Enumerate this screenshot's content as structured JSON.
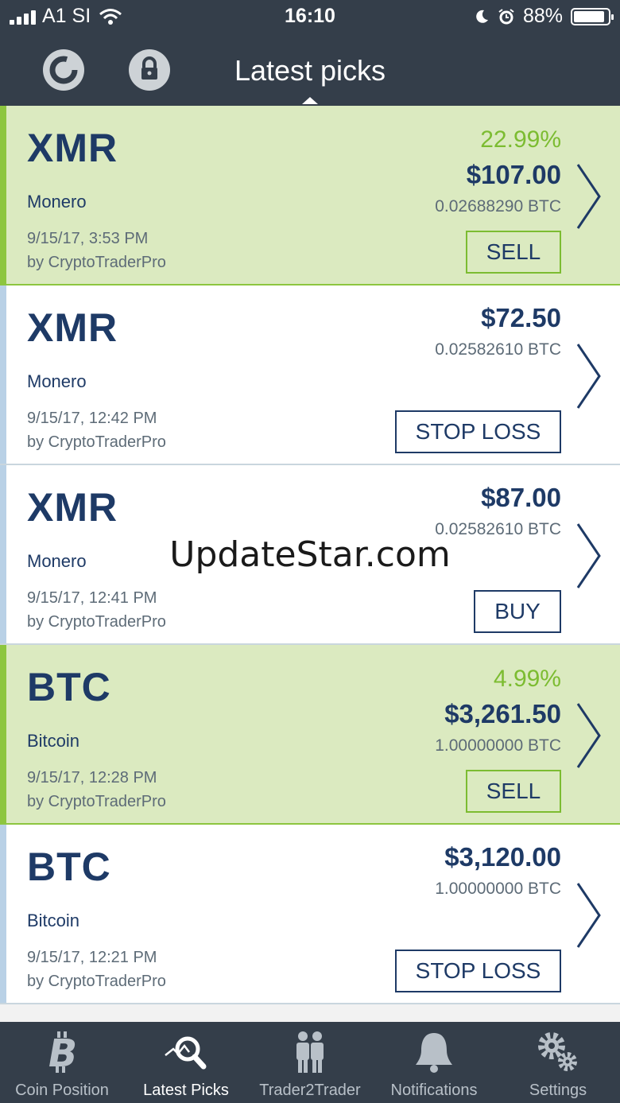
{
  "status_bar": {
    "carrier": "A1 SI",
    "time": "16:10",
    "battery": "88%"
  },
  "nav": {
    "title": "Latest picks",
    "icons": [
      "refresh-icon",
      "lock-icon"
    ]
  },
  "watermark": "UpdateStar.com",
  "picks": [
    {
      "symbol": "XMR",
      "name": "Monero",
      "date": "9/15/17, 3:53 PM",
      "author": "by CryptoTraderPro",
      "percent": "22.99%",
      "price": "$107.00",
      "btc": "0.02688290 BTC",
      "action": "SELL",
      "state": "positive"
    },
    {
      "symbol": "XMR",
      "name": "Monero",
      "date": "9/15/17, 12:42 PM",
      "author": "by CryptoTraderPro",
      "price": "$72.50",
      "btc": "0.02582610 BTC",
      "action": "STOP LOSS",
      "state": "neutral"
    },
    {
      "symbol": "XMR",
      "name": "Monero",
      "date": "9/15/17, 12:41 PM",
      "author": "by CryptoTraderPro",
      "price": "$87.00",
      "btc": "0.02582610 BTC",
      "action": "BUY",
      "state": "neutral"
    },
    {
      "symbol": "BTC",
      "name": "Bitcoin",
      "date": "9/15/17, 12:28 PM",
      "author": "by CryptoTraderPro",
      "percent": "4.99%",
      "price": "$3,261.50",
      "btc": "1.00000000 BTC",
      "action": "SELL",
      "state": "positive"
    },
    {
      "symbol": "BTC",
      "name": "Bitcoin",
      "date": "9/15/17, 12:21 PM",
      "author": "by CryptoTraderPro",
      "price": "$3,120.00",
      "btc": "1.00000000 BTC",
      "action": "STOP LOSS",
      "state": "neutral"
    }
  ],
  "tabs": [
    {
      "label": "Coin Position",
      "icon": "bitcoin-icon"
    },
    {
      "label": "Latest Picks",
      "icon": "search-chart-icon",
      "active": true
    },
    {
      "label": "Trader2Trader",
      "icon": "people-icon"
    },
    {
      "label": "Notifications",
      "icon": "bell-icon"
    },
    {
      "label": "Settings",
      "icon": "gear-icon"
    }
  ],
  "colors": {
    "header": "#343e4a",
    "positive_bg": "#dbeac0",
    "positive_accent": "#8dc63f",
    "text_primary": "#1e3a66"
  }
}
